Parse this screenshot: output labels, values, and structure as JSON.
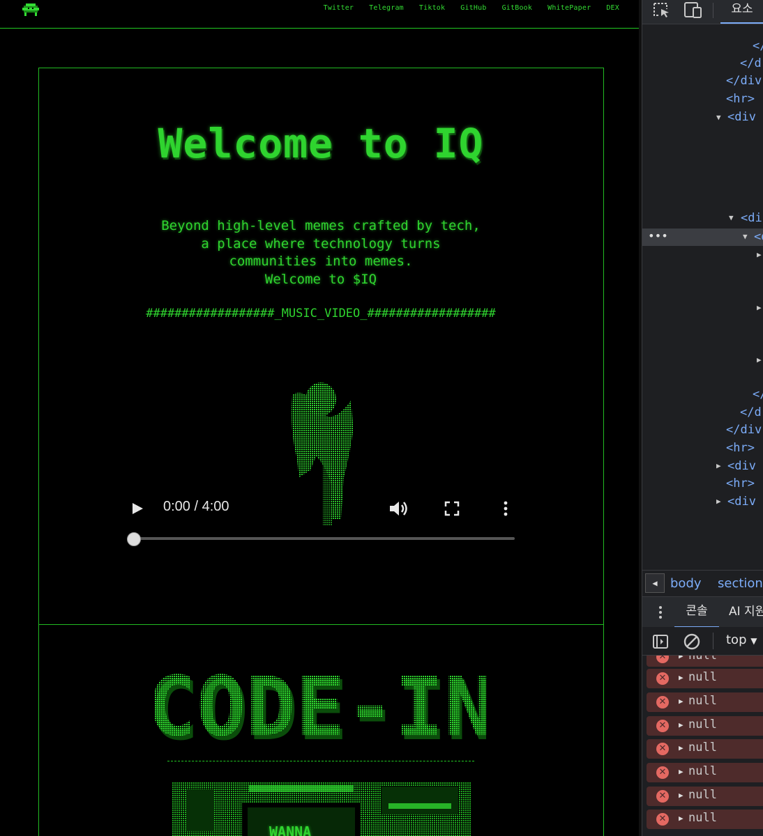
{
  "site": {
    "nav": [
      "Twitter",
      "Telegram",
      "Tiktok",
      "GitHub",
      "GitBook",
      "WhitePaper",
      "DEX"
    ],
    "hero": {
      "title": "Welcome to IQ",
      "tagline": [
        "Beyond high-level memes crafted by tech,",
        "a place where technology turns",
        "communities into memes.",
        "Welcome to $IQ"
      ],
      "music_video_header": "##################_MUSIC_VIDEO_##################"
    },
    "video": {
      "time": "0:00 / 4:00",
      "progress": 0
    },
    "codein": {
      "title": "CODE-IN",
      "sign_text": "WANNA"
    }
  },
  "devtools": {
    "elements_tab": "요소",
    "dom_lines": [
      "</",
      "</d",
      "</div",
      "<hr>",
      "<div",
      "<di",
      "<d",
      "</",
      "</d",
      "</div",
      "<hr>",
      "<div",
      "<hr>",
      "<div"
    ],
    "breadcrumb": [
      "body",
      "section"
    ],
    "drawer_tabs": [
      "콘솔",
      "AI 지원"
    ],
    "context": "top",
    "console_messages": [
      "null",
      "null",
      "null",
      "null",
      "null",
      "null",
      "null",
      "null"
    ]
  },
  "colors": {
    "terminal_green": "#2fd42f",
    "devtools_bg": "#1e1f22",
    "error_row": "#4e2b2b",
    "link_blue": "#7cacf8"
  }
}
